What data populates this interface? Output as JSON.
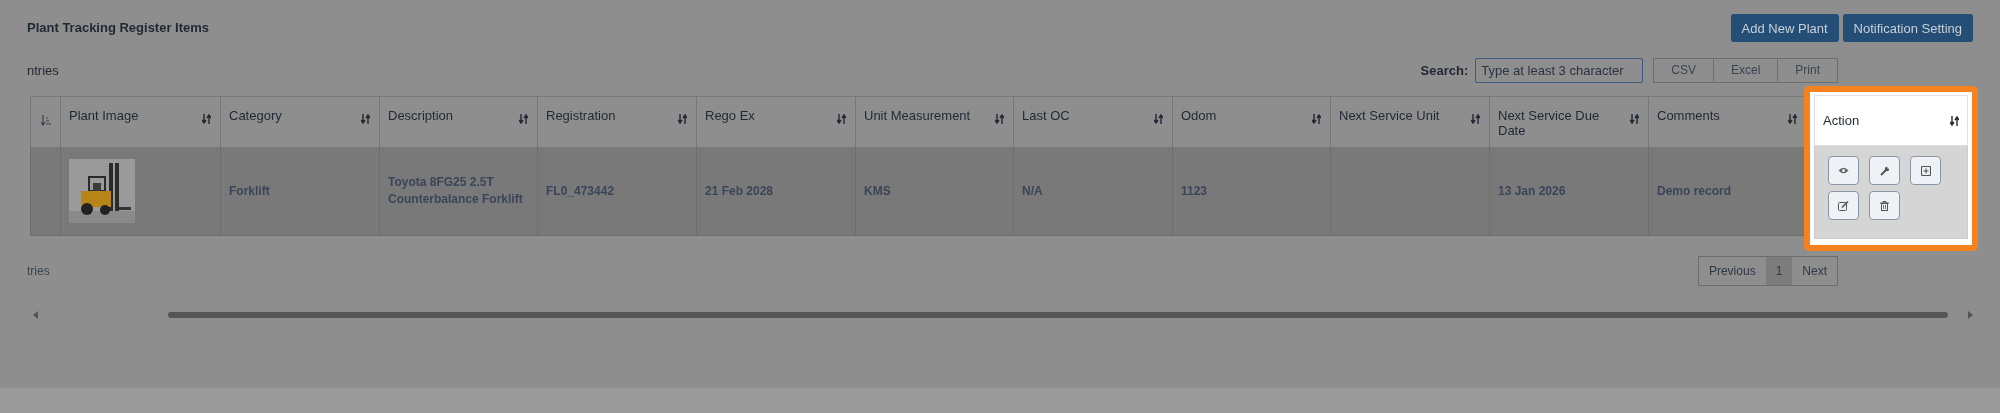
{
  "title": "Plant Tracking Register Items",
  "buttons": [
    "Add New Plant",
    "Notification Setting"
  ],
  "entries_label": "ntries",
  "search": {
    "label": "Search:",
    "placeholder": "Type at least 3 character"
  },
  "export_buttons": [
    "CSV",
    "Excel",
    "Print"
  ],
  "table": {
    "columns": [
      {
        "label": "Plant Image",
        "highlight": false
      },
      {
        "label": "Category",
        "highlight": false
      },
      {
        "label": "Description",
        "highlight": false
      },
      {
        "label": "Registration",
        "highlight": false
      },
      {
        "label": "Rego Ex",
        "highlight": false
      },
      {
        "label": "Unit Measurement",
        "highlight": false
      },
      {
        "label": "Last OC",
        "highlight": false
      },
      {
        "label": "Odom",
        "highlight": false
      },
      {
        "label": "Next Service Unit",
        "highlight": false
      },
      {
        "label": "Next Service Due Date",
        "highlight": false
      },
      {
        "label": "Comments",
        "highlight": false
      },
      {
        "label": "Action",
        "highlight": true
      }
    ],
    "rows": [
      {
        "cells": [
          {
            "kind": "picture"
          },
          {
            "kind": "text",
            "text": "Forklift"
          },
          {
            "kind": "text",
            "text": "Toyota 8FG25 2.5T Counterbalance Forklift"
          },
          {
            "kind": "text",
            "text": "FL0_473442"
          },
          {
            "kind": "text",
            "text": "21 Feb 2028"
          },
          {
            "kind": "text",
            "text": "KMS"
          },
          {
            "kind": "text",
            "text": "N/A"
          },
          {
            "kind": "text",
            "text": "1123"
          },
          {
            "kind": "empty"
          },
          {
            "kind": "text",
            "text": "13 Jan 2026"
          },
          {
            "kind": "text",
            "text": "Demo record"
          },
          {
            "kind": "actions",
            "actions": [
              {
                "kind": "view"
              },
              {
                "kind": "service"
              },
              {
                "kind": "add"
              },
              {
                "kind": "edit"
              },
              {
                "kind": "delete"
              }
            ]
          }
        ]
      }
    ]
  },
  "footer_info": "tries",
  "pagination": [
    {
      "label": "Previous",
      "selected": false
    },
    {
      "label": "1",
      "selected": true
    },
    {
      "label": "Next",
      "selected": false
    }
  ]
}
